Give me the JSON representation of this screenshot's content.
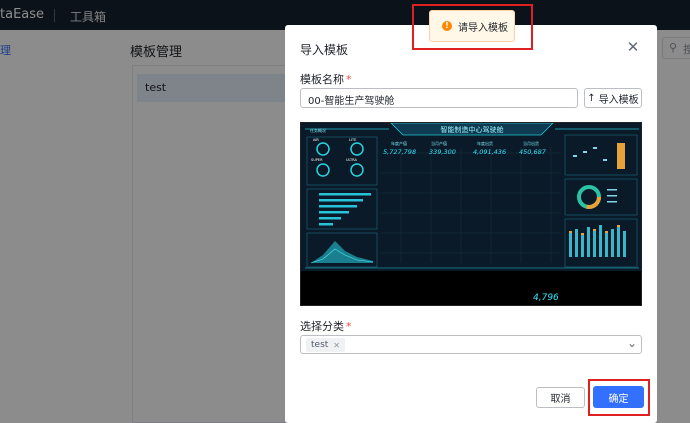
{
  "topbar": {
    "brand": "taEase",
    "toolbox": "工具箱"
  },
  "page": {
    "left_item": "理",
    "title": "模板管理",
    "categories": [
      "test"
    ],
    "search_text": "捜"
  },
  "dialog": {
    "title": "导入模板",
    "name_label": "模板名称",
    "name_value": "00-智能生产驾驶舱",
    "import_button": "导入模板",
    "preview": {
      "title": "智能制造中心驾驶舱",
      "left_title_1": "任务概况",
      "gauges": [
        "AIR",
        "LITE",
        "SUPER",
        "ULTRA"
      ],
      "kpi_labels": [
        "年度产值",
        "当月产值",
        "年度出货",
        "当月出货"
      ],
      "kpi_values": [
        "5,727,798",
        "339,300",
        "4,091,436",
        "450,687"
      ],
      "bottom_value": "4,796"
    },
    "category_label": "选择分类",
    "selected_tag": "test",
    "cancel_button": "取消",
    "confirm_button": "确定"
  },
  "toast": {
    "message": "请导入模板",
    "type": "warning"
  },
  "colors": {
    "primary": "#3370ff",
    "warning": "#ff8800",
    "annotation": "#e02020"
  }
}
